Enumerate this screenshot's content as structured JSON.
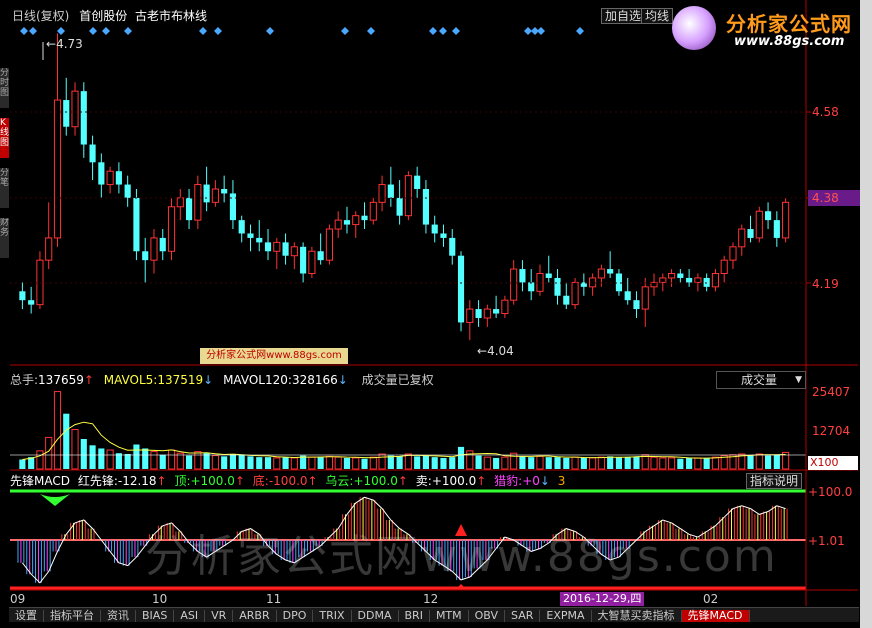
{
  "header": {
    "period": "日线(复权)",
    "indicator_name": "首创股份",
    "note": "古老市布林线",
    "btn_watch": "加自选",
    "btn_line": "均线"
  },
  "watermark": {
    "logo_text": "分析家公式网",
    "url": "www.88gs.com",
    "bottom_text": "分析家公式网www.88gs.com",
    "small_badge": "分析家公式网www.88gs.com"
  },
  "volume_panel": {
    "total_label": "总手:",
    "total_value": "137659",
    "mavol5_label": "MAVOL5:",
    "mavol5_value": "137519",
    "mavol120_label": "MAVOL120:",
    "mavol120_value": "328166",
    "status": "成交量已复权",
    "selector": "成交量",
    "selector_arrow": "▼",
    "unit": "X100"
  },
  "macd_panel": {
    "name": "先锋MACD",
    "red_label": "红先锋:",
    "red_value": "-12.18",
    "top_label": "顶:",
    "top_value": "+100.0",
    "bottom_label": "底:",
    "bottom_value": "-100.0",
    "cloud_label": "乌云:",
    "cloud_value": "+100.0",
    "sell_label": "卖:",
    "sell_value": "+100.0",
    "hunt_label": "猎豹:",
    "hunt_value": "+0",
    "extra": "3",
    "help_btn": "指标说明"
  },
  "axis": {
    "price_ticks": [
      "4.58",
      "4.38",
      "4.19"
    ],
    "current_price": "4.38",
    "vol_ticks": [
      "25407",
      "12704"
    ],
    "macd_ticks": [
      "+100.0",
      "+1.01"
    ],
    "x_ticks": [
      "09",
      "10",
      "11",
      "12",
      "02"
    ],
    "cursor_date": "2016-12-29,四",
    "high_label": "4.73",
    "low_label": "4.04"
  },
  "colors": {
    "up": "#ff3333",
    "down": "#54ffff",
    "axis": "#b00000",
    "price_label": "#ff4040",
    "current_bg": "#6a1b8a",
    "yellow": "#ffff40",
    "green": "#33ff33",
    "marker": "#4aa8ff",
    "magenta": "#ff44ff",
    "orange": "#ffa500"
  },
  "tabs": [
    "设置",
    "指标平台",
    "资讯",
    "BIAS",
    "ASI",
    "VR",
    "ARBR",
    "DPO",
    "TRIX",
    "DDMA",
    "BRI",
    "MTM",
    "OBV",
    "SAR",
    "EXPMA",
    "大智慧买卖指标",
    "先锋MACD"
  ],
  "side_tabs": [
    "分时图",
    "K线图",
    "分笔",
    "财务"
  ],
  "chart_data": {
    "type": "candlestick",
    "title": "",
    "xlabel": "",
    "ylabel": "",
    "ylim": [
      4.0,
      4.76
    ],
    "x_ticks": [
      "09",
      "10",
      "11",
      "12",
      "02"
    ],
    "series_note": "ohlc values estimated from chart",
    "ohlc": [
      [
        4.15,
        4.17,
        4.11,
        4.13
      ],
      [
        4.13,
        4.16,
        4.1,
        4.12
      ],
      [
        4.12,
        4.24,
        4.11,
        4.22
      ],
      [
        4.22,
        4.35,
        4.2,
        4.27
      ],
      [
        4.27,
        4.73,
        4.25,
        4.58
      ],
      [
        4.58,
        4.63,
        4.5,
        4.52
      ],
      [
        4.52,
        4.62,
        4.5,
        4.6
      ],
      [
        4.6,
        4.62,
        4.45,
        4.48
      ],
      [
        4.48,
        4.5,
        4.4,
        4.44
      ],
      [
        4.44,
        4.46,
        4.36,
        4.39
      ],
      [
        4.39,
        4.43,
        4.37,
        4.42
      ],
      [
        4.42,
        4.44,
        4.37,
        4.39
      ],
      [
        4.39,
        4.41,
        4.34,
        4.36
      ],
      [
        4.36,
        4.38,
        4.22,
        4.24
      ],
      [
        4.24,
        4.27,
        4.17,
        4.22
      ],
      [
        4.22,
        4.29,
        4.19,
        4.27
      ],
      [
        4.27,
        4.29,
        4.22,
        4.24
      ],
      [
        4.24,
        4.36,
        4.22,
        4.34
      ],
      [
        4.34,
        4.38,
        4.31,
        4.36
      ],
      [
        4.36,
        4.38,
        4.29,
        4.31
      ],
      [
        4.31,
        4.41,
        4.29,
        4.39
      ],
      [
        4.39,
        4.43,
        4.33,
        4.35
      ],
      [
        4.35,
        4.4,
        4.34,
        4.38
      ],
      [
        4.38,
        4.41,
        4.35,
        4.37
      ],
      [
        4.37,
        4.4,
        4.29,
        4.31
      ],
      [
        4.31,
        4.32,
        4.26,
        4.28
      ],
      [
        4.28,
        4.3,
        4.24,
        4.27
      ],
      [
        4.27,
        4.31,
        4.24,
        4.26
      ],
      [
        4.26,
        4.29,
        4.22,
        4.24
      ],
      [
        4.24,
        4.27,
        4.2,
        4.26
      ],
      [
        4.26,
        4.28,
        4.21,
        4.23
      ],
      [
        4.23,
        4.26,
        4.2,
        4.25
      ],
      [
        4.25,
        4.26,
        4.17,
        4.19
      ],
      [
        4.19,
        4.25,
        4.18,
        4.24
      ],
      [
        4.24,
        4.28,
        4.21,
        4.22
      ],
      [
        4.22,
        4.3,
        4.21,
        4.29
      ],
      [
        4.29,
        4.33,
        4.27,
        4.31
      ],
      [
        4.31,
        4.34,
        4.28,
        4.3
      ],
      [
        4.3,
        4.33,
        4.27,
        4.32
      ],
      [
        4.32,
        4.35,
        4.29,
        4.31
      ],
      [
        4.31,
        4.36,
        4.3,
        4.35
      ],
      [
        4.35,
        4.41,
        4.33,
        4.39
      ],
      [
        4.39,
        4.43,
        4.34,
        4.36
      ],
      [
        4.36,
        4.4,
        4.3,
        4.32
      ],
      [
        4.32,
        4.42,
        4.31,
        4.41
      ],
      [
        4.41,
        4.43,
        4.36,
        4.38
      ],
      [
        4.38,
        4.4,
        4.28,
        4.3
      ],
      [
        4.3,
        4.32,
        4.26,
        4.28
      ],
      [
        4.28,
        4.3,
        4.25,
        4.27
      ],
      [
        4.27,
        4.29,
        4.21,
        4.23
      ],
      [
        4.23,
        4.24,
        4.06,
        4.08
      ],
      [
        4.08,
        4.13,
        4.04,
        4.11
      ],
      [
        4.11,
        4.13,
        4.07,
        4.09
      ],
      [
        4.09,
        4.12,
        4.07,
        4.11
      ],
      [
        4.11,
        4.14,
        4.09,
        4.1
      ],
      [
        4.1,
        4.14,
        4.09,
        4.13
      ],
      [
        4.13,
        4.22,
        4.12,
        4.2
      ],
      [
        4.2,
        4.22,
        4.15,
        4.17
      ],
      [
        4.17,
        4.2,
        4.13,
        4.15
      ],
      [
        4.15,
        4.21,
        4.14,
        4.19
      ],
      [
        4.19,
        4.23,
        4.17,
        4.18
      ],
      [
        4.18,
        4.2,
        4.12,
        4.14
      ],
      [
        4.14,
        4.17,
        4.11,
        4.12
      ],
      [
        4.12,
        4.18,
        4.11,
        4.17
      ],
      [
        4.17,
        4.19,
        4.14,
        4.16
      ],
      [
        4.16,
        4.19,
        4.14,
        4.18
      ],
      [
        4.18,
        4.21,
        4.16,
        4.2
      ],
      [
        4.2,
        4.24,
        4.18,
        4.19
      ],
      [
        4.19,
        4.2,
        4.14,
        4.15
      ],
      [
        4.15,
        4.18,
        4.12,
        4.13
      ],
      [
        4.13,
        4.15,
        4.09,
        4.11
      ],
      [
        4.11,
        4.18,
        4.07,
        4.16
      ],
      [
        4.16,
        4.19,
        4.14,
        4.17
      ],
      [
        4.17,
        4.19,
        4.15,
        4.18
      ],
      [
        4.18,
        4.2,
        4.16,
        4.19
      ],
      [
        4.19,
        4.2,
        4.17,
        4.18
      ],
      [
        4.18,
        4.2,
        4.16,
        4.17
      ],
      [
        4.17,
        4.19,
        4.15,
        4.18
      ],
      [
        4.18,
        4.19,
        4.15,
        4.16
      ],
      [
        4.16,
        4.2,
        4.15,
        4.19
      ],
      [
        4.19,
        4.23,
        4.17,
        4.22
      ],
      [
        4.22,
        4.26,
        4.2,
        4.25
      ],
      [
        4.25,
        4.3,
        4.23,
        4.29
      ],
      [
        4.29,
        4.32,
        4.26,
        4.27
      ],
      [
        4.27,
        4.34,
        4.26,
        4.33
      ],
      [
        4.33,
        4.35,
        4.29,
        4.31
      ],
      [
        4.31,
        4.33,
        4.25,
        4.27
      ],
      [
        4.27,
        4.36,
        4.26,
        4.35
      ]
    ],
    "volume": [
      120,
      150,
      230,
      400,
      980,
      700,
      500,
      380,
      300,
      260,
      240,
      200,
      190,
      310,
      260,
      220,
      180,
      240,
      200,
      170,
      220,
      200,
      170,
      160,
      190,
      180,
      160,
      150,
      150,
      140,
      150,
      140,
      170,
      150,
      150,
      160,
      150,
      140,
      140,
      130,
      150,
      190,
      170,
      160,
      190,
      160,
      170,
      150,
      140,
      150,
      280,
      230,
      170,
      150,
      140,
      150,
      200,
      160,
      150,
      160,
      150,
      150,
      140,
      150,
      140,
      140,
      150,
      160,
      150,
      150,
      160,
      180,
      150,
      140,
      140,
      130,
      140,
      140,
      140,
      150,
      170,
      180,
      190,
      170,
      190,
      170,
      180,
      210
    ],
    "vol_ylim": [
      0,
      25407
    ],
    "vol_scale": 25.407,
    "macd": [
      -40,
      -60,
      -75,
      -55,
      -20,
      10,
      30,
      35,
      20,
      0,
      -20,
      -40,
      -45,
      -30,
      -10,
      10,
      25,
      30,
      15,
      -5,
      -20,
      -30,
      -20,
      -10,
      0,
      15,
      20,
      10,
      -10,
      -25,
      -35,
      -40,
      -30,
      -20,
      -10,
      5,
      20,
      45,
      65,
      75,
      70,
      55,
      35,
      20,
      10,
      -5,
      -20,
      -35,
      -45,
      -55,
      -70,
      -65,
      -50,
      -35,
      -15,
      5,
      0,
      -10,
      -20,
      -15,
      -5,
      10,
      20,
      15,
      5,
      -10,
      -25,
      -35,
      -30,
      -15,
      0,
      15,
      25,
      35,
      30,
      20,
      10,
      5,
      15,
      25,
      40,
      55,
      60,
      55,
      45,
      50,
      60,
      55
    ],
    "macd_ylim": [
      -100,
      100
    ],
    "signal_marker_index": 50
  }
}
